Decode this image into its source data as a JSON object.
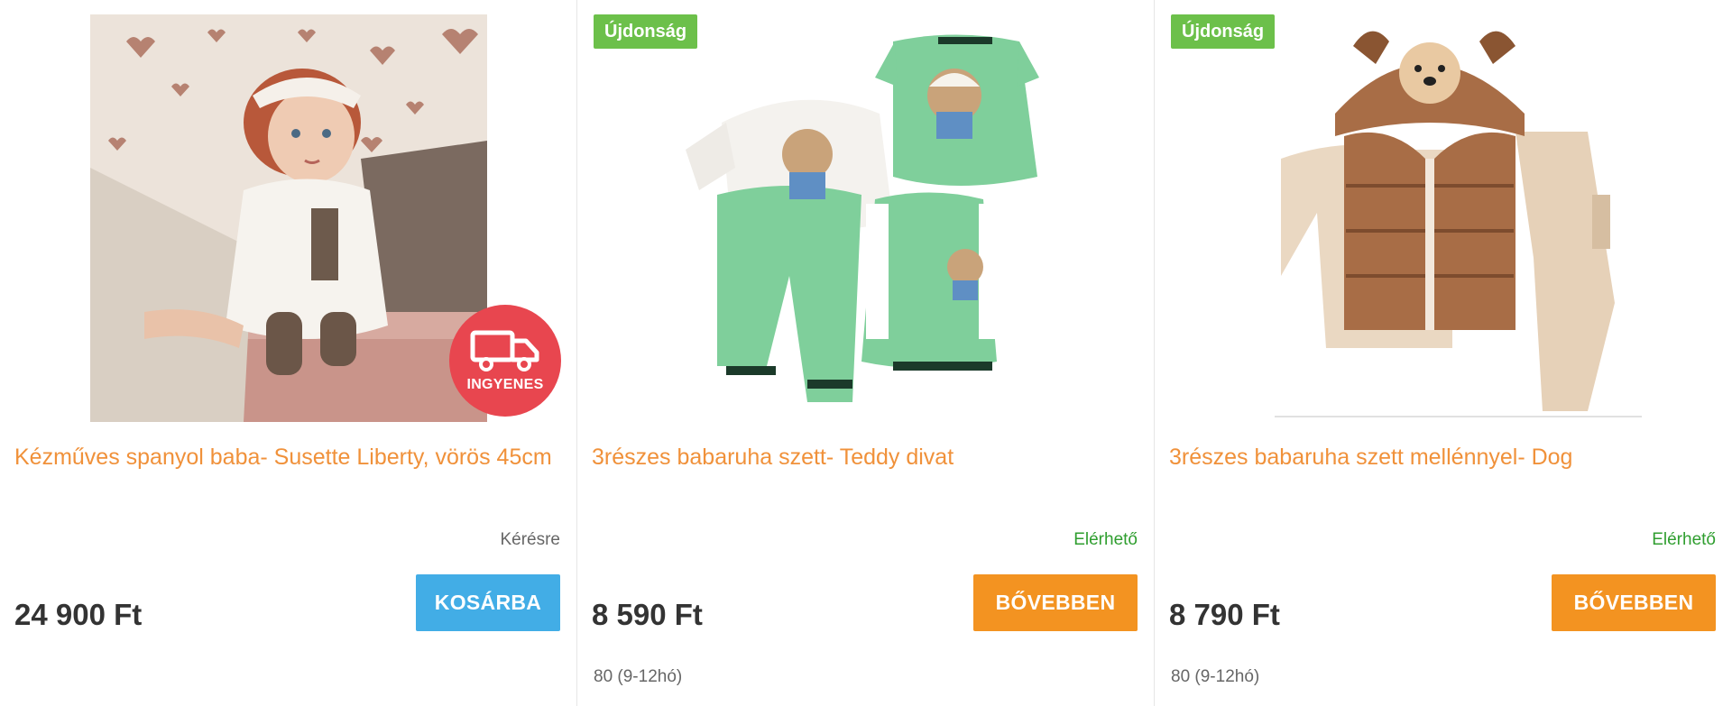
{
  "products": [
    {
      "title": "Kézműves spanyol baba- Susette Liberty, vörös 45cm",
      "badge_free_shipping": "INGYENES",
      "availability": "Kérésre",
      "price": "24 900 Ft",
      "button_label": "KOSÁRBA",
      "image_icon": "doll-photo",
      "accent_color": "#42ade6"
    },
    {
      "badge_new": "Újdonság",
      "title": "3részes babaruha szett- Teddy divat",
      "availability": "Elérhető",
      "price": "8 590 Ft",
      "button_label": "BŐVEBBEN",
      "size": "80 (9-12hó)",
      "image_icon": "green-teddy-outfit-photo",
      "accent_color": "#f39321"
    },
    {
      "badge_new": "Újdonság",
      "title": "3részes babaruha szett mellénnyel- Dog",
      "availability": "Elérhető",
      "price": "8 790 Ft",
      "button_label": "BŐVEBBEN",
      "size": "80 (9-12hó)",
      "image_icon": "brown-dog-vest-outfit-photo",
      "accent_color": "#f39321"
    }
  ]
}
